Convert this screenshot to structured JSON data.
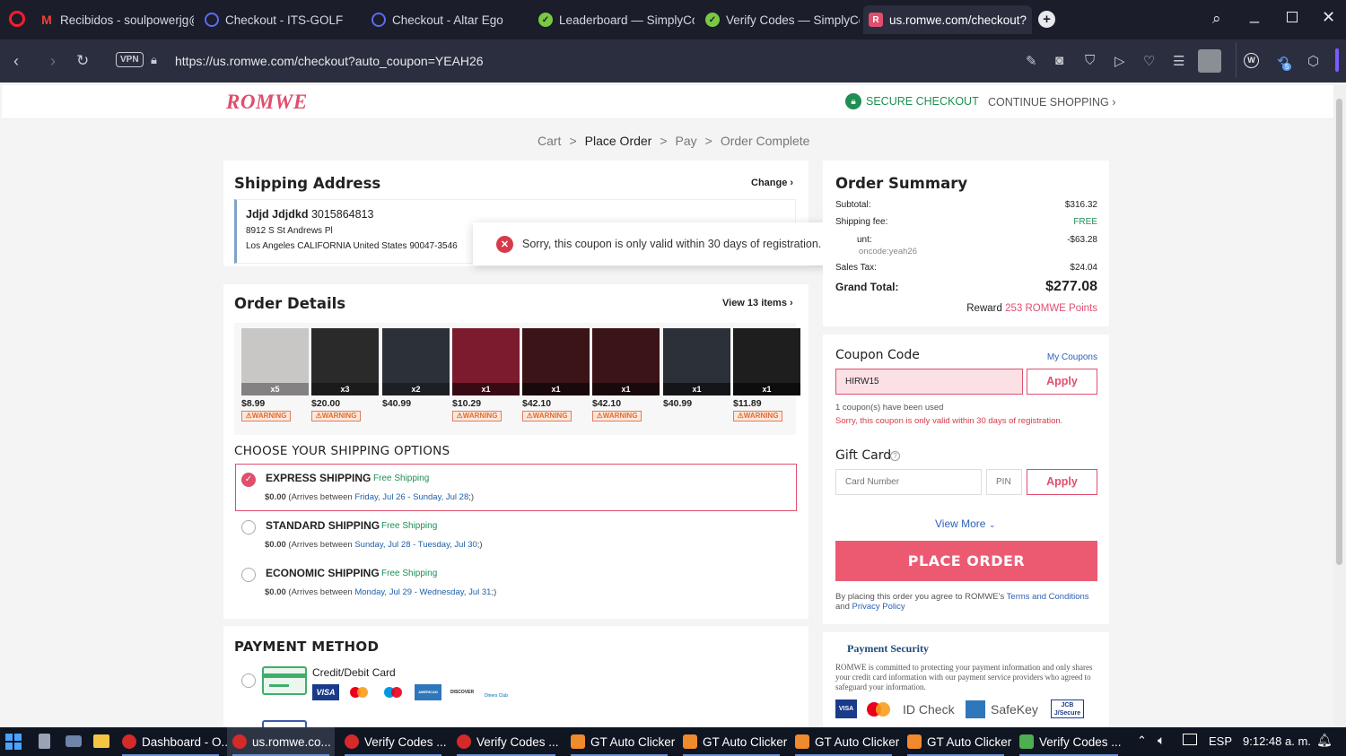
{
  "browser": {
    "tabs": [
      {
        "title": "Recibidos - soulpowerjg@",
        "icon": "gmail-icon"
      },
      {
        "title": "Checkout - ITS-GOLF",
        "icon": "generic-site-icon"
      },
      {
        "title": "Checkout - Altar Ego",
        "icon": "generic-site-icon"
      },
      {
        "title": "Leaderboard — SimplyCo",
        "icon": "simplycodes-icon"
      },
      {
        "title": "Verify Codes — SimplyCo",
        "icon": "simplycodes-icon"
      },
      {
        "title": "us.romwe.com/checkout?",
        "icon": "romwe-icon"
      }
    ],
    "url": "https://us.romwe.com/checkout?auto_coupon=YEAH26",
    "vpn_label": "VPN",
    "badge_count": "5"
  },
  "header": {
    "logo": "ROMWE",
    "secure_checkout": "SECURE CHECKOUT",
    "continue_shopping": "CONTINUE SHOPPING"
  },
  "breadcrumb": {
    "steps": [
      "Cart",
      "Place Order",
      "Pay",
      "Order Complete"
    ],
    "separator": ">"
  },
  "shipping_address": {
    "title": "Shipping Address",
    "change": "Change",
    "name": "Jdjd Jdjdkd",
    "phone": "3015864813",
    "line1": "8912 S St Andrews Pl",
    "line2": "Los Angeles CALIFORNIA United States 90047-3546"
  },
  "toast": {
    "message": "Sorry, this coupon is only valid within 30 days of registration."
  },
  "order_details": {
    "title": "Order Details",
    "view_items": "View 13 items",
    "products": [
      {
        "price": "$8.99",
        "qty": "x5",
        "warning": "WARNING",
        "color": "#c9c7c6"
      },
      {
        "price": "$20.00",
        "qty": "x3",
        "warning": "WARNING",
        "color": "#2a2a2a"
      },
      {
        "price": "$40.99",
        "qty": "x2",
        "warning": "",
        "color": "#2c3038"
      },
      {
        "price": "$10.29",
        "qty": "x1",
        "warning": "WARNING",
        "color": "#7c1a2e"
      },
      {
        "price": "$42.10",
        "qty": "x1",
        "warning": "WARNING",
        "color": "#3b1418"
      },
      {
        "price": "$42.10",
        "qty": "x1",
        "warning": "WARNING",
        "color": "#3b1418"
      },
      {
        "price": "$40.99",
        "qty": "x1",
        "warning": "",
        "color": "#2c3038"
      },
      {
        "price": "$11.89",
        "qty": "x1",
        "warning": "WARNING",
        "color": "#1e1e1e"
      }
    ]
  },
  "shipping_options": {
    "title": "CHOOSE YOUR SHIPPING OPTIONS",
    "options": [
      {
        "name": "EXPRESS SHIPPING",
        "tag": "Free Shipping",
        "price": "$0.00",
        "pre": "(Arrives between ",
        "dates": "Friday, Jul 26 - Sunday, Jul 28",
        "post": ";)",
        "selected": true
      },
      {
        "name": "STANDARD SHIPPING",
        "tag": "Free Shipping",
        "price": "$0.00",
        "pre": "(Arrives between ",
        "dates": "Sunday, Jul 28 - Tuesday, Jul 30",
        "post": ";)",
        "selected": false
      },
      {
        "name": "ECONOMIC SHIPPING",
        "tag": "Free Shipping",
        "price": "$0.00",
        "pre": "(Arrives between ",
        "dates": "Monday, Jul 29 - Wednesday, Jul 31",
        "post": ";)",
        "selected": false
      }
    ]
  },
  "payment": {
    "title": "PAYMENT METHOD",
    "method": "Credit/Debit Card",
    "cards": [
      "VISA",
      "mastercard",
      "maestro",
      "AMERICAN EXPRESS",
      "DISCOVER",
      "Diners Club"
    ]
  },
  "order_summary": {
    "title": "Order Summary",
    "subtotal_label": "Subtotal:",
    "subtotal": "$316.32",
    "shipping_label": "Shipping fee:",
    "shipping": "FREE",
    "discount_label": "unt:",
    "discount": "-$63.28",
    "promo_note": "oncode:yeah26",
    "tax_label": "Sales Tax:",
    "tax": "$24.04",
    "grand_label": "Grand Total:",
    "grand": "$277.08",
    "reward_pre": "Reward",
    "reward_points": "253",
    "reward_post": "ROMWE Points"
  },
  "coupon": {
    "title": "Coupon Code",
    "my_coupons": "My Coupons",
    "value": "HIRW15",
    "apply": "Apply",
    "used_note": "1 coupon(s) have been used",
    "error": "Sorry, this coupon is only valid within 30 days of registration."
  },
  "gift_card": {
    "title": "Gift Card",
    "card_placeholder": "Card Number",
    "pin_placeholder": "PIN",
    "apply": "Apply",
    "view_more": "View More"
  },
  "place_order": "PLACE ORDER",
  "terms": {
    "pre": "By placing this order you agree to ROMWE's ",
    "terms": "Terms and Conditions",
    "mid": " and ",
    "privacy": "Privacy Policy"
  },
  "payment_security": {
    "title": "Payment Security",
    "text": "ROMWE is committed to protecting your payment information and only shares your credit card information with our payment service providers who agreed to safeguard your information.",
    "badges": [
      "VISA",
      "ID Check",
      "SafeKey",
      "JCB J/Secure"
    ]
  },
  "taskbar": {
    "items": [
      "Dashboard - O...",
      "us.romwe.co...",
      "Verify Codes ...",
      "Verify Codes ...",
      "GT Auto Clicker",
      "GT Auto Clicker",
      "GT Auto Clicker",
      "GT Auto Clicker",
      "Verify Codes ..."
    ],
    "lang": "ESP",
    "time": "9:12:48 a. m."
  },
  "colors": {
    "brand": "#e04f6e",
    "secure_green": "#1f8e54",
    "taskbar": "#101522",
    "browser": "#1b1d2a"
  }
}
